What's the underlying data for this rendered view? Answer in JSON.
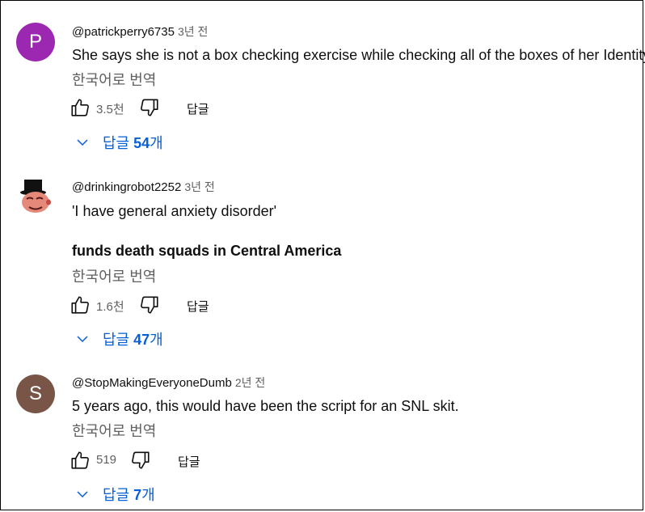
{
  "comments": [
    {
      "avatar_letter": "P",
      "avatar_color": "#9c27b0",
      "author": "@patrickperry6735",
      "time": "3년 전",
      "text_lines": [
        "She says she is not a box checking exercise while checking all of the boxes of her Identity."
      ],
      "translate": "한국어로 번역",
      "likes": "3.5천",
      "reply_label": "답글",
      "replies_prefix": "답글 ",
      "replies_count": "54",
      "replies_suffix": "개"
    },
    {
      "avatar_icon": "tophat-character-icon",
      "author": "@drinkingrobot2252",
      "time": "3년 전",
      "text_lines": [
        "'I have general anxiety disorder'",
        "funds death squads in Central America"
      ],
      "translate": "한국어로 번역",
      "likes": "1.6천",
      "reply_label": "답글",
      "replies_prefix": "답글 ",
      "replies_count": "47",
      "replies_suffix": "개"
    },
    {
      "avatar_letter": "S",
      "avatar_color": "#795548",
      "author": "@StopMakingEveryoneDumb",
      "time": "2년 전",
      "text_lines": [
        "5 years ago, this would have been the script for an SNL skit."
      ],
      "translate": "한국어로 번역",
      "likes": "519",
      "reply_label": "답글",
      "replies_prefix": "답글 ",
      "replies_count": "7",
      "replies_suffix": "개"
    }
  ],
  "colors": {
    "link_blue": "#065fd4",
    "secondary_text": "#606060"
  }
}
